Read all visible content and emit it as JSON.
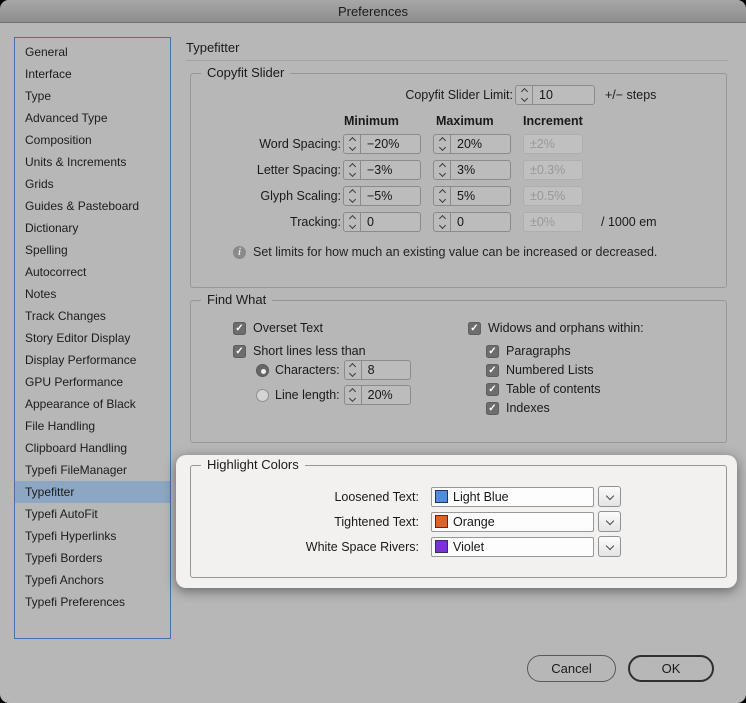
{
  "window": {
    "title": "Preferences"
  },
  "colors": {
    "panel_bg": "#b7b7b7",
    "sidebar_border": "#4a71a3",
    "selected_item_bg": "#8ca6c3",
    "spotlight_bg": "#f2f1ef"
  },
  "sidebar": {
    "selected_index": 20,
    "items": [
      "General",
      "Interface",
      "Type",
      "Advanced Type",
      "Composition",
      "Units & Increments",
      "Grids",
      "Guides & Pasteboard",
      "Dictionary",
      "Spelling",
      "Autocorrect",
      "Notes",
      "Track Changes",
      "Story Editor Display",
      "Display Performance",
      "GPU Performance",
      "Appearance of Black",
      "File Handling",
      "Clipboard Handling",
      "Typefi FileManager",
      "Typefitter",
      "Typefi AutoFit",
      "Typefi Hyperlinks",
      "Typefi Borders",
      "Typefi Anchors",
      "Typefi Preferences"
    ]
  },
  "main": {
    "heading": "Typefitter",
    "copyfit": {
      "legend": "Copyfit Slider",
      "limit_label": "Copyfit Slider Limit:",
      "limit_value": "10",
      "limit_suffix": "+/− steps",
      "col_headers": [
        "Minimum",
        "Maximum",
        "Increment"
      ],
      "rows": [
        {
          "label": "Word Spacing:",
          "min": "−20%",
          "max": "20%",
          "inc": "±2%",
          "suffix": ""
        },
        {
          "label": "Letter Spacing:",
          "min": "−3%",
          "max": "3%",
          "inc": "±0.3%",
          "suffix": ""
        },
        {
          "label": "Glyph Scaling:",
          "min": "−5%",
          "max": "5%",
          "inc": "±0.5%",
          "suffix": ""
        },
        {
          "label": "Tracking:",
          "min": "0",
          "max": "0",
          "inc": "±0%",
          "suffix": "/ 1000 em"
        }
      ],
      "info": "Set limits for how much an existing value can be increased or decreased."
    },
    "find_what": {
      "legend": "Find What",
      "overset_label": "Overset Text",
      "short_lines_label": "Short lines less than",
      "characters_label": "Characters:",
      "characters_value": "8",
      "line_length_label": "Line length:",
      "line_length_value": "20%",
      "widows_label": "Widows and orphans within:",
      "widows_items": [
        "Paragraphs",
        "Numbered Lists",
        "Table of contents",
        "Indexes"
      ]
    },
    "highlight_colors": {
      "legend": "Highlight Colors",
      "rows": [
        {
          "label": "Loosened Text:",
          "value": "Light Blue",
          "swatch": "#4e8edf"
        },
        {
          "label": "Tightened Text:",
          "value": "Orange",
          "swatch": "#df6128"
        },
        {
          "label": "White Space Rivers:",
          "value": "Violet",
          "swatch": "#7f2fdb"
        }
      ]
    }
  },
  "footer": {
    "cancel_label": "Cancel",
    "ok_label": "OK"
  }
}
